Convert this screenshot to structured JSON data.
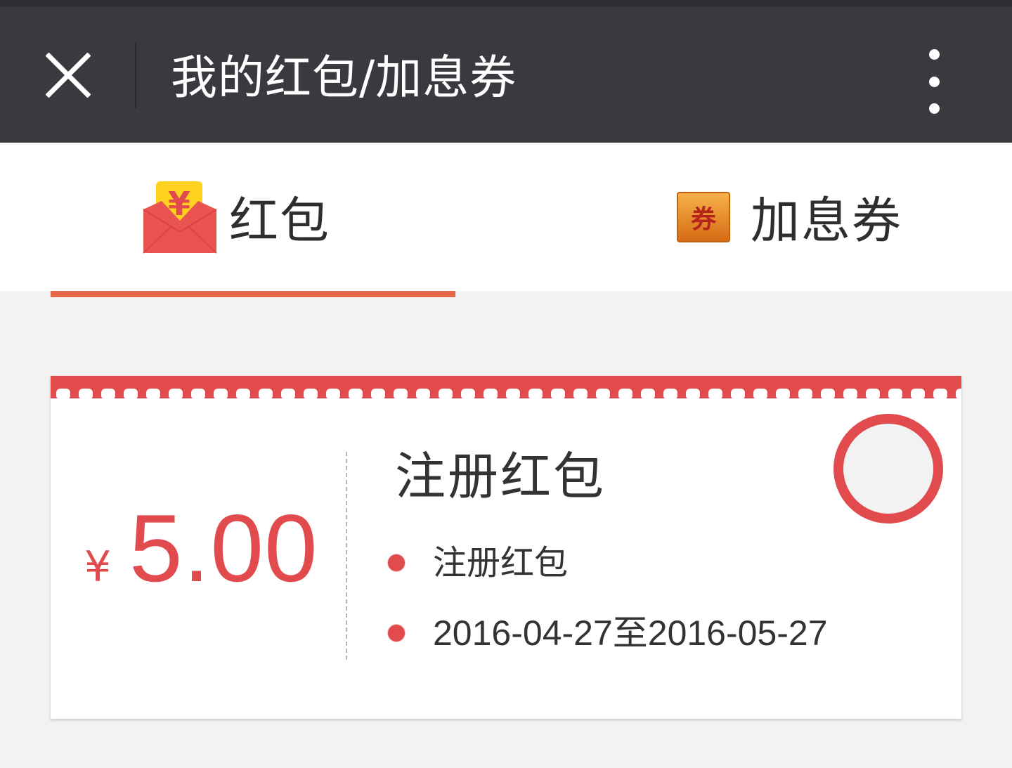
{
  "header": {
    "title": "我的红包/加息券",
    "close_icon": "close-icon",
    "more_icon": "more-vertical-icon"
  },
  "tabs": [
    {
      "label": "红包",
      "icon": "red-envelope-icon",
      "active": true
    },
    {
      "label": "加息券",
      "icon": "coupon-ticket-icon",
      "active": false
    }
  ],
  "coupon": {
    "currency_symbol": "¥",
    "amount": "5.00",
    "title": "注册红包",
    "details": [
      "注册红包",
      "2016-04-27至2016-05-27"
    ],
    "selected": false
  },
  "colors": {
    "topbar": "#393a3f",
    "accent_red": "#e14b4d",
    "tab_indicator": "#e8674a",
    "page_bg": "#f2f2f2"
  }
}
